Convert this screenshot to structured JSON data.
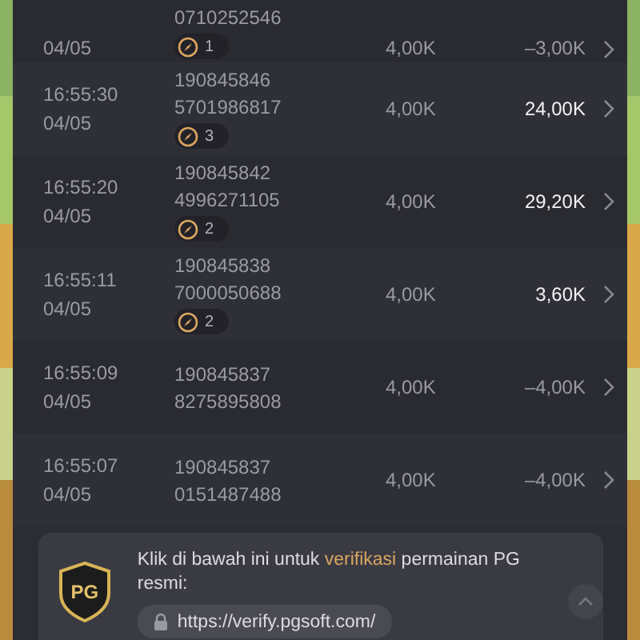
{
  "rows": [
    {
      "date": "04/05",
      "ids": [
        "0710252546"
      ],
      "badge": "1",
      "bet": "4,00K",
      "profit": "–3,00K",
      "win": false,
      "partial": true
    },
    {
      "time": "16:55:30",
      "date": "04/05",
      "ids": [
        "190845846",
        "5701986817"
      ],
      "badge": "3",
      "bet": "4,00K",
      "profit": "24,00K",
      "win": true
    },
    {
      "time": "16:55:20",
      "date": "04/05",
      "ids": [
        "190845842",
        "4996271105"
      ],
      "badge": "2",
      "bet": "4,00K",
      "profit": "29,20K",
      "win": true
    },
    {
      "time": "16:55:11",
      "date": "04/05",
      "ids": [
        "190845838",
        "7000050688"
      ],
      "badge": "2",
      "bet": "4,00K",
      "profit": "3,60K",
      "win": true
    },
    {
      "time": "16:55:09",
      "date": "04/05",
      "ids": [
        "190845837",
        "8275895808"
      ],
      "bet": "4,00K",
      "profit": "–4,00K",
      "win": false
    },
    {
      "time": "16:55:07",
      "date": "04/05",
      "ids": [
        "190845837",
        "0151487488"
      ],
      "bet": "4,00K",
      "profit": "–4,00K",
      "win": false
    }
  ],
  "verify": {
    "logo": "PG",
    "message": "Klik di bawah ini untuk **verifikasi** permainan PG resmi:",
    "url": "https://verify.pgsoft.com/"
  }
}
